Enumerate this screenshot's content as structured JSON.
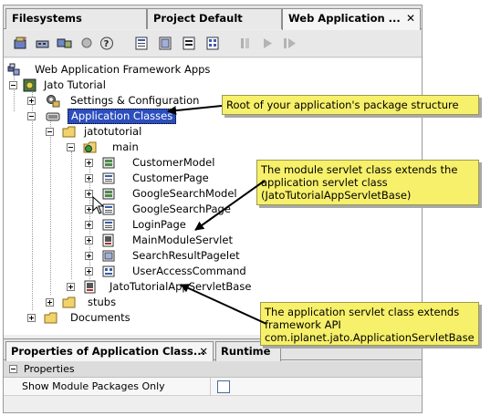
{
  "tabs": [
    {
      "label": "Filesystems"
    },
    {
      "label": "Project Default"
    },
    {
      "label": "Web Application ...",
      "close": "✕"
    }
  ],
  "toolbar": {
    "icons": [
      "new-module-icon",
      "mount-icon",
      "configure-icon",
      "bulb-icon",
      "help-icon",
      "page-icon-1",
      "page-icon-2",
      "page-icon-3",
      "page-icon-4",
      "bookmark-icon",
      "play-icon",
      "play-next-icon"
    ]
  },
  "tree": {
    "root": "Web Application Framework Apps",
    "app": "Jato Tutorial",
    "settings": "Settings & Configuration",
    "app_classes": "Application Classes",
    "pkg": "jatotutorial",
    "main": "main",
    "items": [
      "CustomerModel",
      "CustomerPage",
      "GoogleSearchModel",
      "GoogleSearchPage",
      "LoginPage",
      "MainModuleServlet",
      "SearchResultPagelet",
      "UserAccessCommand"
    ],
    "servlet_base": "JatoTutorialAppServletBase",
    "stubs": "stubs",
    "documents": "Documents"
  },
  "properties": {
    "tab_label": "Properties of Application Class...",
    "tab_close": "✕",
    "runtime_tab": "Runtime",
    "section": "Properties",
    "row_label": "Show Module Packages Only",
    "checked": false
  },
  "callouts": {
    "root": "Root of your application's package structure",
    "module": "The module servlet class extends the application servlet class (JatoTutorialAppServletBase)",
    "app_servlet": "The application servlet class extends framework API com.iplanet.jato.ApplicationServletBase"
  },
  "colors": {
    "selection": "#2c4ebd",
    "callout": "#f7f06a"
  }
}
